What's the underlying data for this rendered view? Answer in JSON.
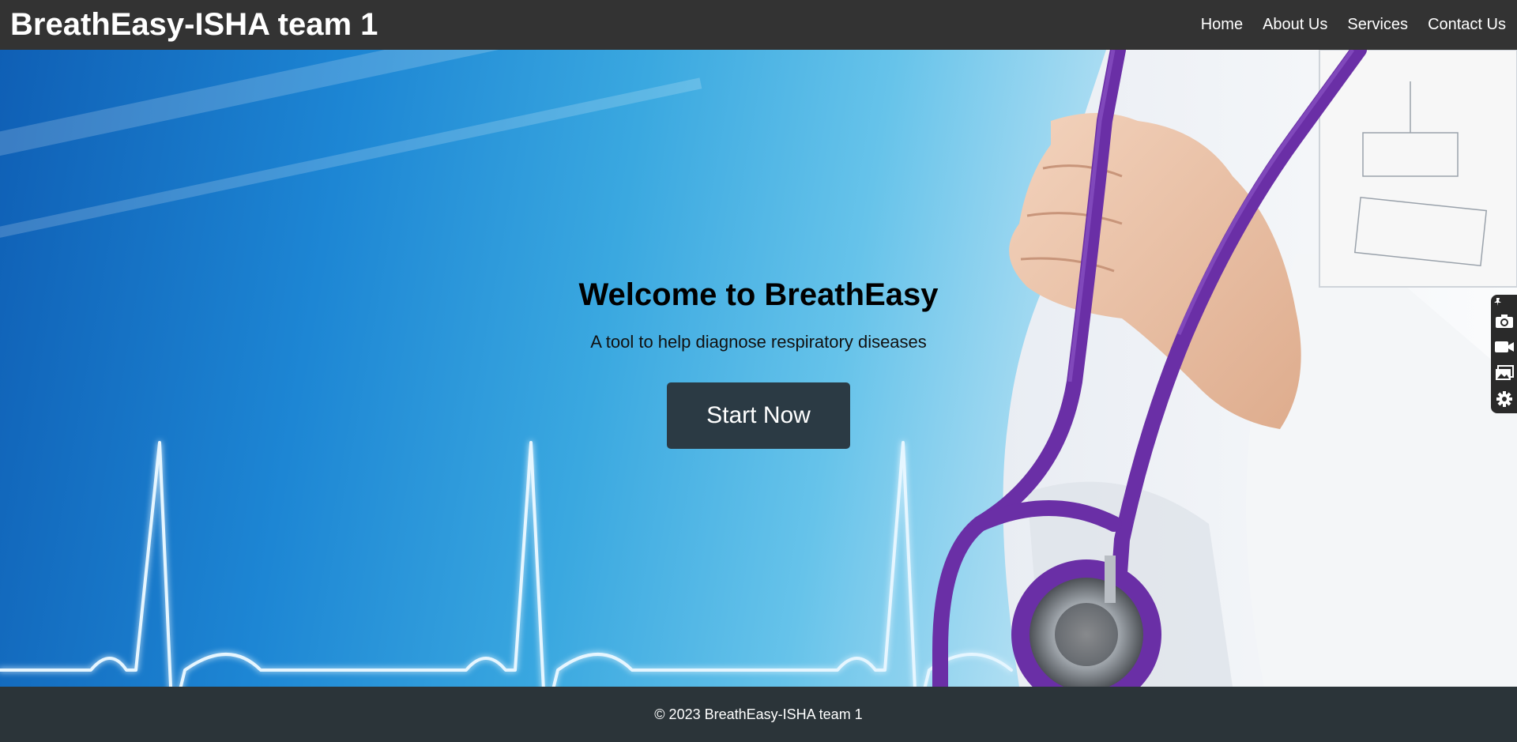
{
  "navbar": {
    "brand": "BreathEasy-ISHA team 1",
    "links": [
      "Home",
      "About Us",
      "Services",
      "Contact Us"
    ]
  },
  "hero": {
    "title": "Welcome to BreathEasy",
    "subtitle": "A tool to help diagnose respiratory diseases",
    "button_label": "Start Now"
  },
  "footer": {
    "copyright": "© 2023 BreathEasy-ISHA team 1"
  },
  "toolbar": {
    "icons": [
      "pin-icon",
      "camera-icon",
      "video-icon",
      "gallery-icon",
      "gear-icon"
    ]
  },
  "colors": {
    "navbar_bg": "#333333",
    "button_bg": "#2b3a44",
    "stethoscope": "#6a2fa6",
    "ecg_line": "#e6f6ff"
  }
}
